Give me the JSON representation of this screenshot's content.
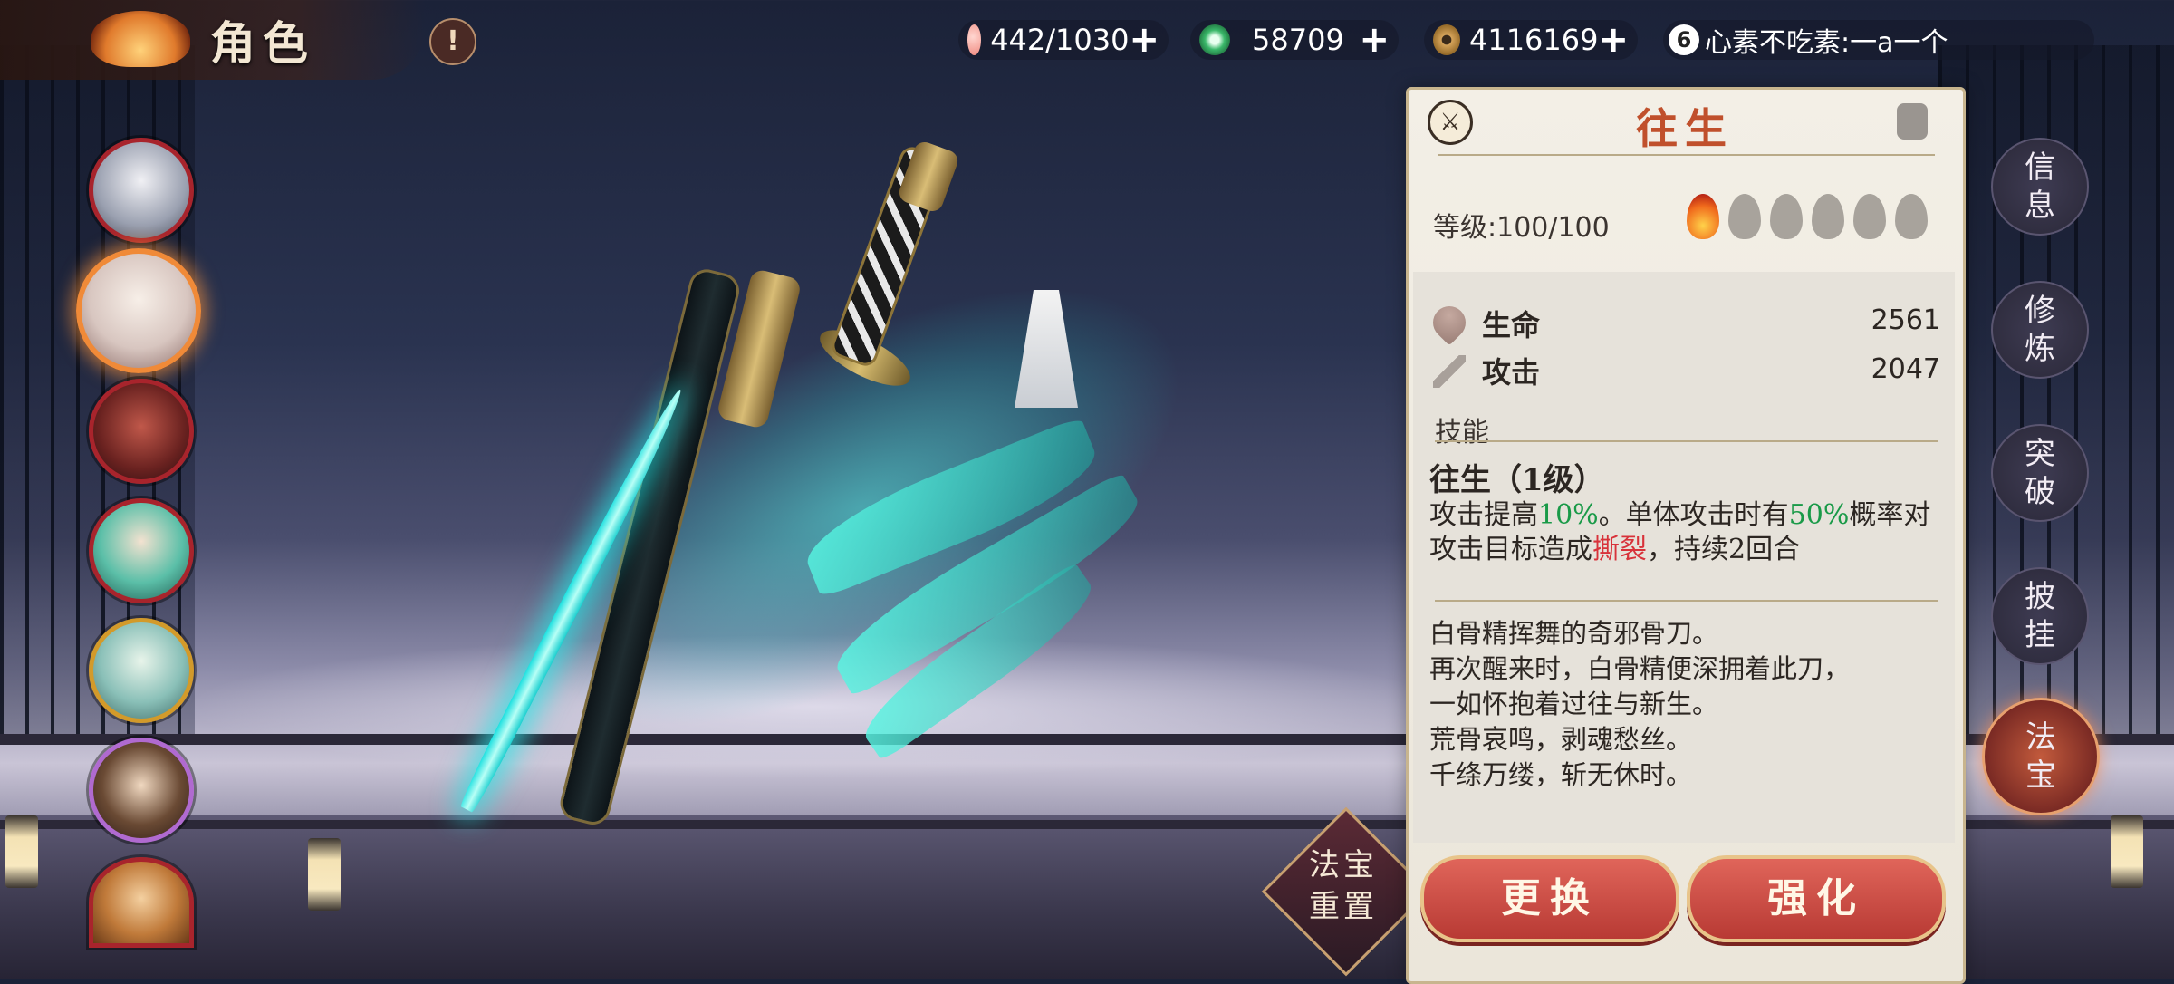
{
  "header": {
    "title": "角色",
    "info_icon": "exclamation-icon"
  },
  "resources": [
    {
      "name": "stamina",
      "value": "442/1030",
      "icon": "peach-icon",
      "color": "#f4a0a0"
    },
    {
      "name": "jade",
      "value": "58709",
      "icon": "jade-swirl-icon",
      "color": "#3ab86a"
    },
    {
      "name": "coins",
      "value": "4116169",
      "icon": "coin-icon",
      "color": "#d6a45a"
    }
  ],
  "chat": {
    "badge": "6",
    "text": "心素不吃素:一a一个"
  },
  "characters": [
    {
      "name": "character-1",
      "border": "red"
    },
    {
      "name": "character-2",
      "border": "selected"
    },
    {
      "name": "character-3",
      "border": "red"
    },
    {
      "name": "character-4",
      "border": "red"
    },
    {
      "name": "character-5",
      "border": "gold"
    },
    {
      "name": "character-6",
      "border": "purple"
    },
    {
      "name": "character-7",
      "border": "red"
    }
  ],
  "reset_button": {
    "line1": "法宝",
    "line2": "重置"
  },
  "panel": {
    "weapon_name": "往生",
    "level_label": "等级:100/100",
    "stars_total": 6,
    "stars_lit": 1,
    "stats": [
      {
        "icon": "heart-icon",
        "label": "生命",
        "value": "2561"
      },
      {
        "icon": "sword-icon",
        "label": "攻击",
        "value": "2047"
      }
    ],
    "skill_header": "技能",
    "skill_name": "往生（1级）",
    "skill_desc": {
      "p1": "攻击提高",
      "v1": "10%",
      "p2": "。单体攻击时有",
      "v2": "50%",
      "p3": "概率对攻击目标造成",
      "v3": "撕裂",
      "p4": "，持续2回合"
    },
    "lore": [
      "白骨精挥舞的奇邪骨刀。",
      "再次醒来时，白骨精便深拥着此刀，",
      "一如怀抱着过往与新生。",
      "荒骨哀鸣，剥魂愁丝。",
      "千绦万缕，斩无休时。"
    ],
    "buttons": {
      "replace": "更换",
      "strengthen": "强化"
    }
  },
  "tabs": [
    {
      "label": "信息",
      "active": false
    },
    {
      "label": "修炼",
      "active": false
    },
    {
      "label": "突破",
      "active": false
    },
    {
      "label": "披挂",
      "active": false
    },
    {
      "label": "法宝",
      "active": true
    }
  ]
}
